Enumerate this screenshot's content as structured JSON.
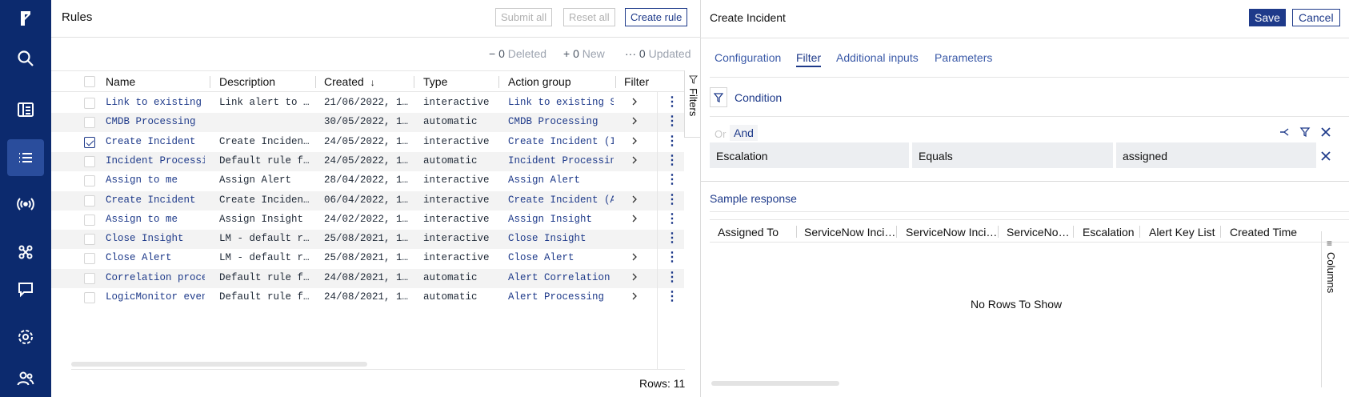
{
  "nav": {
    "items": [
      {
        "name": "logo",
        "icon": "logicmonitor-logo-icon"
      },
      {
        "name": "search",
        "icon": "search-icon"
      },
      {
        "name": "dashboards",
        "icon": "dashboard-icon"
      },
      {
        "name": "rules",
        "icon": "list-icon",
        "active": true
      },
      {
        "name": "integrations",
        "icon": "broadcast-icon"
      },
      {
        "name": "workflows",
        "icon": "nodes-icon"
      },
      {
        "name": "messages",
        "icon": "chat-icon"
      },
      {
        "name": "settings",
        "icon": "gear-icon"
      },
      {
        "name": "users",
        "icon": "users-icon"
      }
    ]
  },
  "rules": {
    "title": "Rules",
    "submit_all": "Submit all",
    "reset_all": "Reset all",
    "create_rule": "Create rule",
    "counts": {
      "deleted_symbol": "−",
      "deleted_value": "0",
      "deleted_label": "Deleted",
      "new_symbol": "+",
      "new_value": "0",
      "new_label": "New",
      "updated_symbol": "···",
      "updated_value": "0",
      "updated_label": "Updated"
    },
    "columns": {
      "name": "Name",
      "description": "Description",
      "created": "Created",
      "type": "Type",
      "action_group": "Action group",
      "filter": "Filter"
    },
    "sort_indicator": "↓",
    "filters_tab": "Filters",
    "rows": [
      {
        "name": "Link to existing",
        "description": "Link alert to …",
        "created": "21/06/2022, 1…",
        "type": "interactive",
        "action_group": "Link to existing Se",
        "has_filter": true,
        "checked": false
      },
      {
        "name": "CMDB Processing",
        "description": "",
        "created": "30/05/2022, 1…",
        "type": "automatic",
        "action_group": "CMDB Processing",
        "has_filter": true,
        "checked": false
      },
      {
        "name": "Create Incident",
        "description": "Create Inciden…",
        "created": "24/05/2022, 1…",
        "type": "interactive",
        "action_group": "Create Incident (In",
        "has_filter": true,
        "checked": true
      },
      {
        "name": "Incident Processi",
        "description": "Default rule f…",
        "created": "24/05/2022, 1…",
        "type": "automatic",
        "action_group": "Incident Processing",
        "has_filter": true,
        "checked": false
      },
      {
        "name": "Assign to me",
        "description": "Assign Alert",
        "created": "28/04/2022, 1…",
        "type": "interactive",
        "action_group": "Assign Alert",
        "has_filter": false,
        "checked": false
      },
      {
        "name": "Create Incident",
        "description": "Create Inciden…",
        "created": "06/04/2022, 1…",
        "type": "interactive",
        "action_group": "Create Incident (Al",
        "has_filter": true,
        "checked": false
      },
      {
        "name": "Assign to me",
        "description": "Assign Insight",
        "created": "24/02/2022, 1…",
        "type": "interactive",
        "action_group": "Assign Insight",
        "has_filter": true,
        "checked": false
      },
      {
        "name": "Close Insight",
        "description": "LM - default r…",
        "created": "25/08/2021, 1…",
        "type": "interactive",
        "action_group": "Close Insight",
        "has_filter": false,
        "checked": false
      },
      {
        "name": "Close Alert",
        "description": "LM - default r…",
        "created": "25/08/2021, 1…",
        "type": "interactive",
        "action_group": "Close Alert",
        "has_filter": true,
        "checked": false
      },
      {
        "name": "Correlation proce",
        "description": "Default rule f…",
        "created": "24/08/2021, 1…",
        "type": "automatic",
        "action_group": "Alert Correlation",
        "has_filter": true,
        "checked": false
      },
      {
        "name": "LogicMonitor even",
        "description": "Default rule f…",
        "created": "24/08/2021, 1…",
        "type": "automatic",
        "action_group": "Alert Processing",
        "has_filter": true,
        "checked": false
      }
    ],
    "rows_count": "Rows: 11"
  },
  "panel": {
    "title": "Create Incident",
    "save": "Save",
    "cancel": "Cancel",
    "tabs": [
      {
        "label": "Configuration",
        "active": false
      },
      {
        "label": "Filter",
        "active": true
      },
      {
        "label": "Additional inputs",
        "active": false
      },
      {
        "label": "Parameters",
        "active": false
      }
    ],
    "condition_label": "Condition",
    "or_label": "Or",
    "and_label": "And",
    "filter_row": {
      "field": "Escalation",
      "operator": "Equals",
      "value": "assigned"
    },
    "sample_response_label": "Sample response",
    "sample_columns": [
      "Assigned To",
      "ServiceNow Inci…",
      "ServiceNow Inci…",
      "ServiceNo…",
      "Escalation",
      "Alert Key List",
      "Created Time"
    ],
    "no_rows": "No Rows To Show",
    "columns_tab": "Columns"
  },
  "colors": {
    "nav_bg": "#0c2a6e",
    "accent": "#1e3a8a",
    "active_nav": "#2a4d9c"
  }
}
